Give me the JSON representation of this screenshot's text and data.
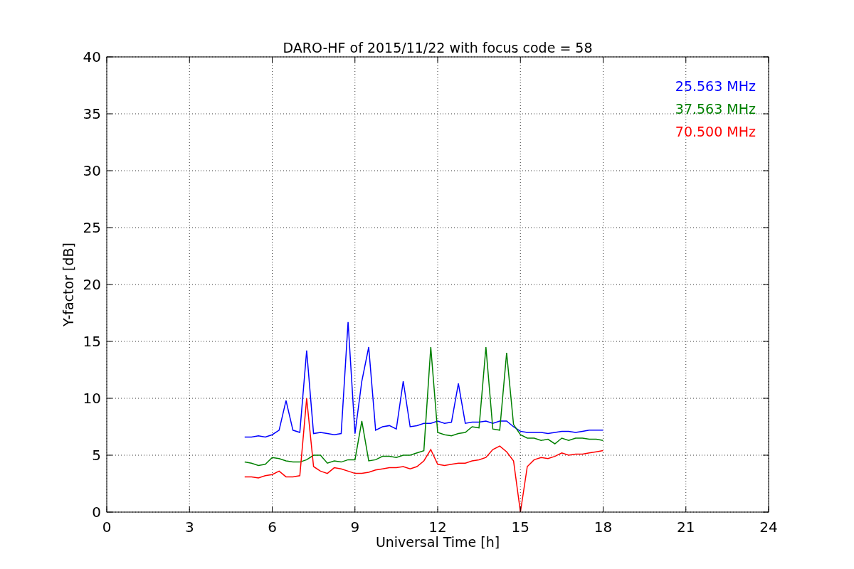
{
  "chart_data": {
    "type": "line",
    "title": "DARO-HF of 2015/11/22 with focus code = 58",
    "xlabel": "Universal Time [h]",
    "ylabel": "Y-factor [dB]",
    "x": [
      5.0,
      5.25,
      5.5,
      5.75,
      6.0,
      6.25,
      6.5,
      6.75,
      7.0,
      7.25,
      7.5,
      7.75,
      8.0,
      8.25,
      8.5,
      8.75,
      9.0,
      9.25,
      9.5,
      9.75,
      10.0,
      10.25,
      10.5,
      10.75,
      11.0,
      11.25,
      11.5,
      11.75,
      12.0,
      12.25,
      12.5,
      12.75,
      13.0,
      13.25,
      13.5,
      13.75,
      14.0,
      14.25,
      14.5,
      14.75,
      15.0,
      15.25,
      15.5,
      15.75,
      16.0,
      16.25,
      16.5,
      16.75,
      17.0,
      17.25,
      17.5,
      17.75,
      18.0
    ],
    "series": [
      {
        "name": "25.563 MHz",
        "color": "#0000ff",
        "values": [
          6.6,
          6.6,
          6.7,
          6.6,
          6.8,
          7.2,
          9.8,
          7.2,
          7.0,
          14.2,
          6.9,
          7.0,
          6.9,
          6.8,
          6.9,
          16.7,
          6.9,
          11.5,
          14.5,
          7.2,
          7.5,
          7.6,
          7.3,
          11.5,
          7.5,
          7.6,
          7.8,
          7.8,
          8.0,
          7.8,
          7.9,
          11.3,
          7.8,
          7.9,
          7.9,
          8.0,
          7.8,
          8.0,
          8.0,
          7.5,
          7.1,
          7.0,
          7.0,
          7.0,
          6.9,
          7.0,
          7.1,
          7.1,
          7.0,
          7.1,
          7.2,
          7.2,
          7.2
        ]
      },
      {
        "name": "37.563 MHz",
        "color": "#008000",
        "values": [
          4.4,
          4.3,
          4.1,
          4.2,
          4.8,
          4.7,
          4.5,
          4.4,
          4.4,
          4.6,
          5.0,
          5.0,
          4.3,
          4.5,
          4.4,
          4.6,
          4.6,
          8.0,
          4.5,
          4.6,
          4.9,
          4.9,
          4.8,
          5.0,
          5.0,
          5.2,
          5.4,
          14.5,
          7.0,
          6.8,
          6.7,
          6.9,
          7.0,
          7.5,
          7.4,
          14.5,
          7.3,
          7.2,
          14.0,
          7.7,
          6.8,
          6.5,
          6.5,
          6.3,
          6.4,
          6.0,
          6.5,
          6.3,
          6.5,
          6.5,
          6.4,
          6.4,
          6.3
        ]
      },
      {
        "name": "70.500 MHz",
        "color": "#ff0000",
        "values": [
          3.1,
          3.1,
          3.0,
          3.2,
          3.3,
          3.6,
          3.1,
          3.1,
          3.2,
          10.0,
          4.0,
          3.6,
          3.4,
          3.9,
          3.8,
          3.6,
          3.4,
          3.4,
          3.5,
          3.7,
          3.8,
          3.9,
          3.9,
          4.0,
          3.8,
          4.0,
          4.5,
          5.5,
          4.2,
          4.1,
          4.2,
          4.3,
          4.3,
          4.5,
          4.6,
          4.8,
          5.5,
          5.8,
          5.3,
          4.5,
          0.0,
          4.0,
          4.6,
          4.8,
          4.7,
          4.9,
          5.2,
          5.0,
          5.1,
          5.1,
          5.2,
          5.3,
          5.4
        ]
      }
    ],
    "grid": true,
    "xlim": [
      0,
      24
    ],
    "ylim": [
      0,
      40
    ],
    "xticks": [
      0,
      3,
      6,
      9,
      12,
      15,
      18,
      21,
      24
    ],
    "yticks": [
      0,
      5,
      10,
      15,
      20,
      25,
      30,
      35,
      40
    ]
  }
}
